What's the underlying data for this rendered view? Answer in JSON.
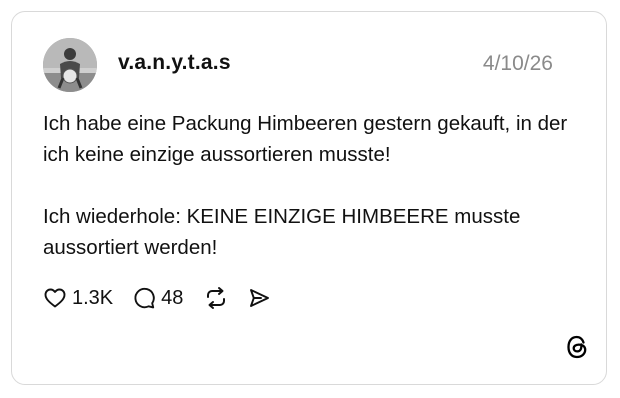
{
  "post": {
    "username": "v.a.n.y.t.a.s",
    "date": "4/10/26",
    "paragraphs": [
      "Ich habe eine Packung Himbeeren gestern gekauft, in der ich keine einzige aussortieren musste!",
      "Ich wiederhole: KEINE EINZIGE HIMBEERE musste aussortiert werden!"
    ],
    "likes": "1.3K",
    "replies": "48"
  },
  "icons": {
    "like": "heart-icon",
    "reply": "speech-bubble-icon",
    "repost": "repost-icon",
    "share": "send-icon",
    "brand": "threads-logo-icon"
  }
}
